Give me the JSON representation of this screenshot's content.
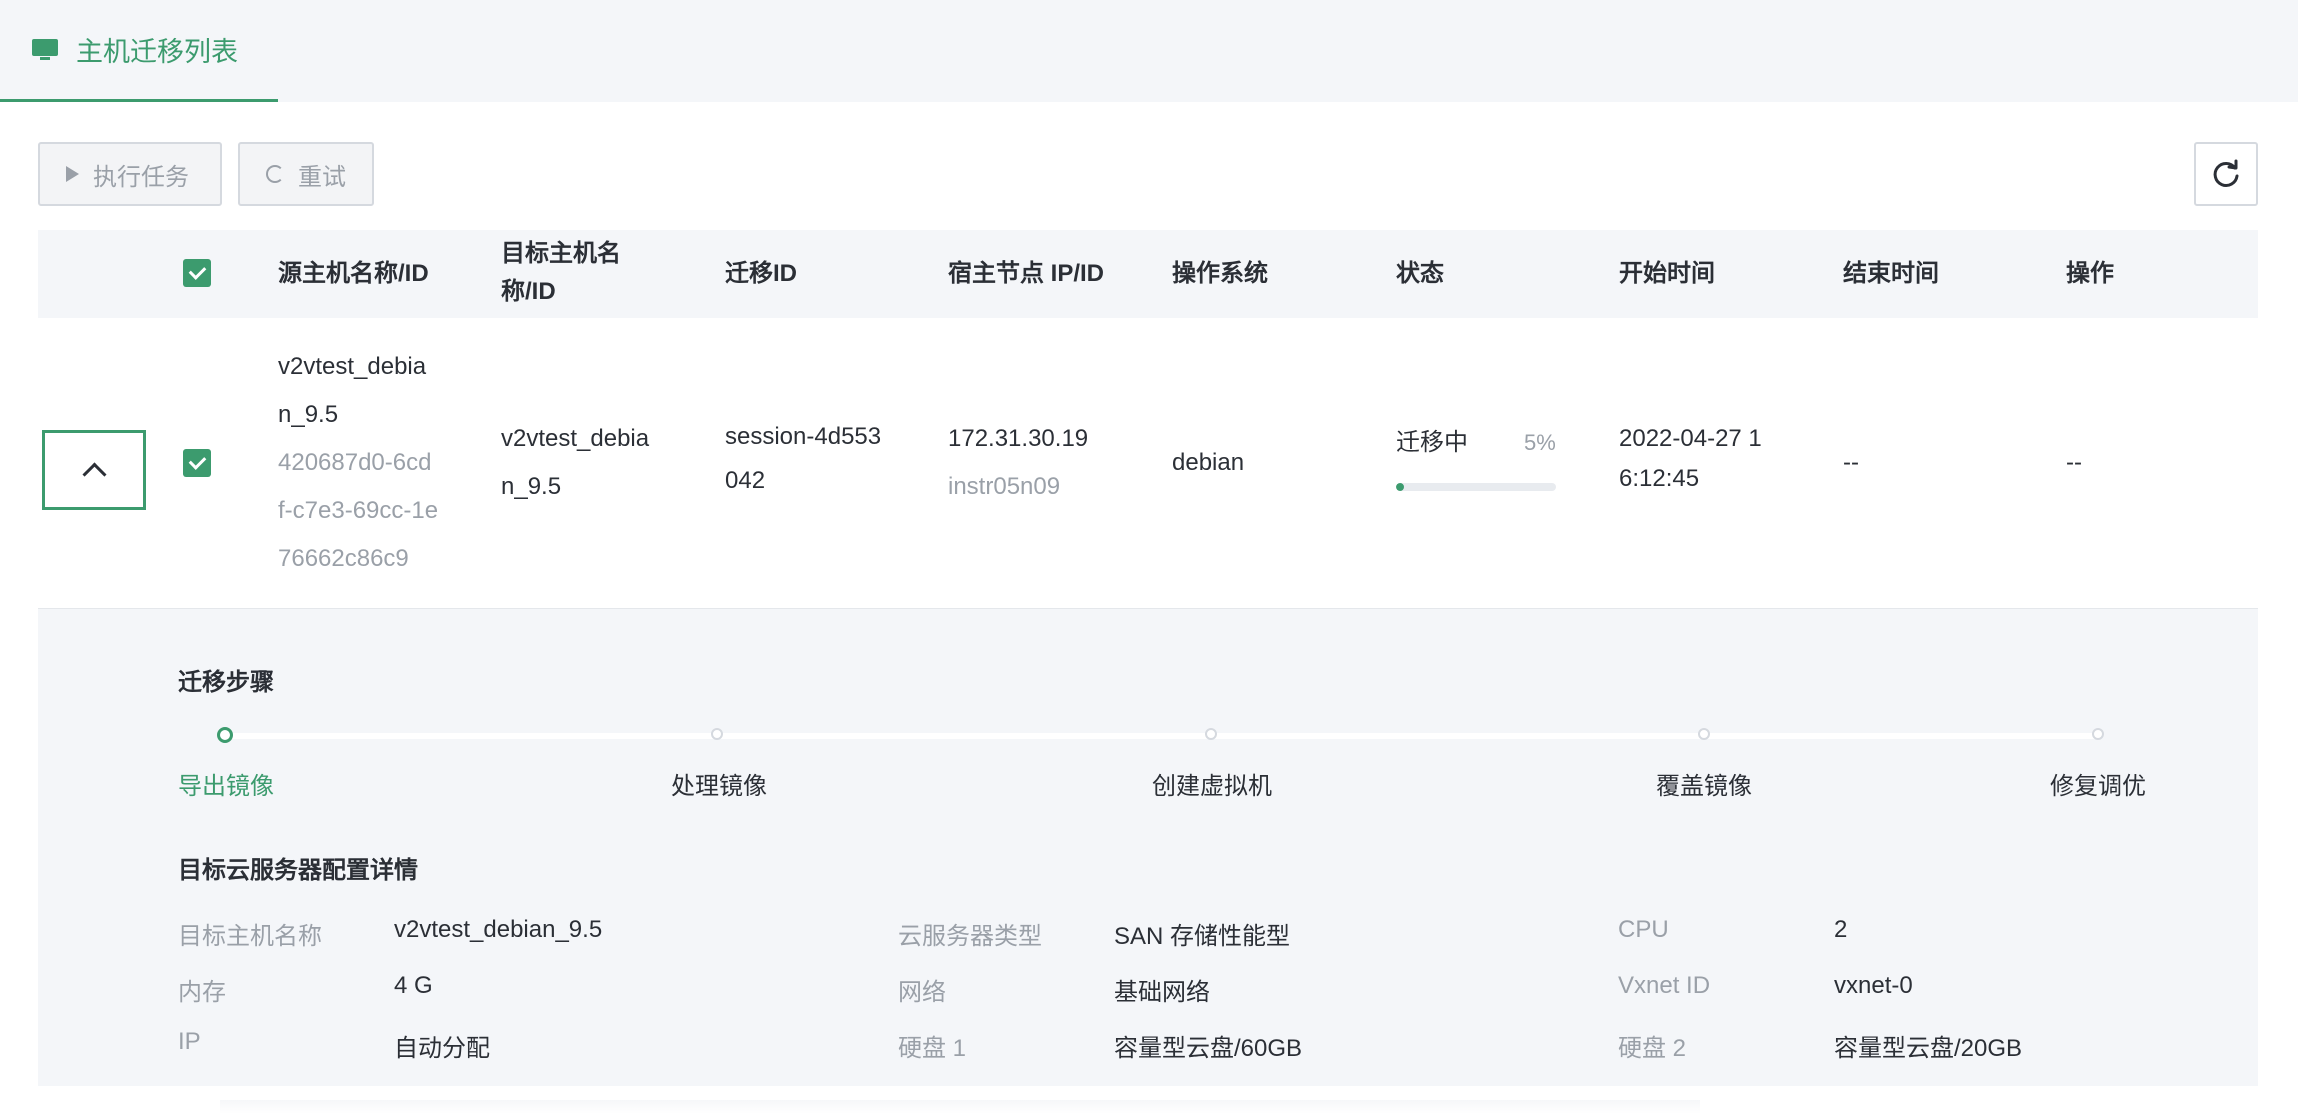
{
  "tab": {
    "title": "主机迁移列表",
    "icon": "monitor-icon"
  },
  "toolbar": {
    "execute_label": "执行任务",
    "retry_label": "重试",
    "refresh_icon": "refresh-icon"
  },
  "table": {
    "columns": [
      "源主机名称/ID",
      "目标主机名称/ID",
      "迁移ID",
      "宿主节点 IP/ID",
      "操作系统",
      "状态",
      "开始时间",
      "结束时间",
      "操作"
    ],
    "column_lines": {
      "target_line1": "目标主机名",
      "target_line2": "称/ID"
    },
    "rows": [
      {
        "source_name_line1": "v2vtest_debia",
        "source_name_line2": "n_9.5",
        "source_id_line1": "420687d0-6cd",
        "source_id_line2": "f-c7e3-69cc-1e",
        "source_id_line3": "76662c86c9",
        "target_line1": "v2vtest_debia",
        "target_line2": "n_9.5",
        "migration_line1": "session-4d553",
        "migration_line2": "042",
        "host_ip": "172.31.30.19",
        "host_id": "instr05n09",
        "os": "debian",
        "status": "迁移中",
        "progress_text": "5%",
        "progress": 0.05,
        "start_line1": "2022-04-27 1",
        "start_line2": "6:12:45",
        "end_time": "--",
        "action": "--"
      }
    ]
  },
  "detail": {
    "steps_title": "迁移步骤",
    "steps": [
      "导出镜像",
      "处理镜像",
      "创建虚拟机",
      "覆盖镜像",
      "修复调优"
    ],
    "active_step": 0,
    "config_title": "目标云服务器配置详情",
    "config": [
      {
        "label": "目标主机名称",
        "value": "v2vtest_debian_9.5"
      },
      {
        "label": "云服务器类型",
        "value": "SAN 存储性能型"
      },
      {
        "label": "CPU",
        "value": "2"
      },
      {
        "label": "内存",
        "value": "4 G"
      },
      {
        "label": "网络",
        "value": "基础网络"
      },
      {
        "label": "Vxnet ID",
        "value": "vxnet-0"
      },
      {
        "label": "IP",
        "value": "自动分配"
      },
      {
        "label": "硬盘 1",
        "value": "容量型云盘/60GB"
      },
      {
        "label": "硬盘 2",
        "value": "容量型云盘/20GB"
      }
    ]
  },
  "colors": {
    "accent": "#3c9b6e",
    "muted": "#9aa0a8",
    "panel": "#f4f6f9"
  }
}
